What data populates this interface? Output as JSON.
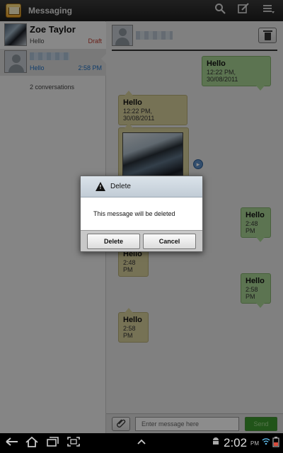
{
  "app": {
    "title": "Messaging",
    "icons": [
      "search-icon",
      "compose-icon",
      "menu-icon"
    ]
  },
  "conversations": [
    {
      "name": "Zoe Taylor",
      "preview": "Hello",
      "status": "Draft",
      "status_color": "#c0392b"
    },
    {
      "name": "",
      "preview": "Hello",
      "time": "2:58 PM",
      "accent": "#1f6fc2"
    }
  ],
  "conversation_count": "2 conversations",
  "thread": {
    "messages": [
      {
        "dir": "out",
        "text": "Hello",
        "time": "12:22 PM, 30/08/2011"
      },
      {
        "dir": "in",
        "text": "Hello",
        "time": "12:22 PM, 30/08/2011"
      },
      {
        "dir": "in",
        "media": "photo"
      },
      {
        "dir": "out",
        "text": "Hello",
        "time": "2:48 PM"
      },
      {
        "dir": "in",
        "text": "Hello",
        "time": "2:48 PM"
      },
      {
        "dir": "out",
        "text": "Hello",
        "time": "2:58 PM"
      },
      {
        "dir": "in",
        "text": "Hello",
        "time": "2:58 PM"
      }
    ]
  },
  "composer": {
    "placeholder": "Enter message here",
    "send_label": "Send"
  },
  "dialog": {
    "title": "Delete",
    "message": "This message will be deleted",
    "confirm_label": "Delete",
    "cancel_label": "Cancel"
  },
  "system_bar": {
    "time": "2:02",
    "ampm": "PM"
  },
  "colors": {
    "incoming_bubble": "#d8cf9c",
    "outgoing_bubble": "#a8d494",
    "send_button": "#3d9a2f"
  }
}
